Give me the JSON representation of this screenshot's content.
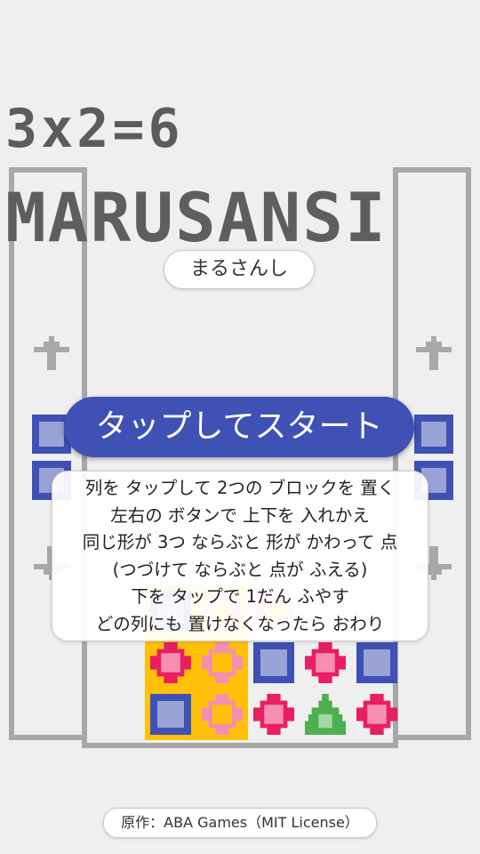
{
  "game": {
    "score_text": "3x2=6",
    "logo_text": "MARUSANSI",
    "subtitle": "まるさんし",
    "start_label": "タップしてスタート",
    "instructions": [
      "列を タップして 2つの ブロックを 置く",
      "左右の ボタンで 上下を 入れかえ",
      "同じ形が 3つ ならぶと 形が かわって 点",
      "(つづけて ならぶと 点が ふえる)",
      "下を タップで 1だん ふやす",
      "どの列にも 置けなくなったら おわり"
    ],
    "credit": "原作：ABA Games（MIT License）"
  },
  "colors": {
    "background": "#efefef",
    "frame": "#a8a8a8",
    "accent": "#3f51b5",
    "square_light": "#9aa3d6",
    "circle": "#e91e63",
    "circle_light": "#f48fb1",
    "triangle": "#4caf50",
    "triangle_light": "#a5d6a7",
    "highlight_column": "#ffc107"
  },
  "side_panels": {
    "left": {
      "up_arrow_icon": "up-arrow-icon",
      "down_arrow_icon": "down-arrow-icon",
      "pieces": [
        "square",
        "square"
      ]
    },
    "right": {
      "up_arrow_icon": "up-arrow-icon",
      "down_arrow_icon": "down-arrow-icon",
      "pieces": [
        "square",
        "square"
      ]
    }
  },
  "grid": {
    "columns": 5,
    "highlighted_columns": [
      0,
      1
    ],
    "rows": [
      [
        "square",
        "circle-light",
        "circle-light",
        null,
        null
      ],
      [
        "circle",
        "circle-light",
        "square",
        "circle",
        "square"
      ],
      [
        "square",
        "circle-light",
        "circle",
        "triangle",
        "circle"
      ]
    ]
  }
}
